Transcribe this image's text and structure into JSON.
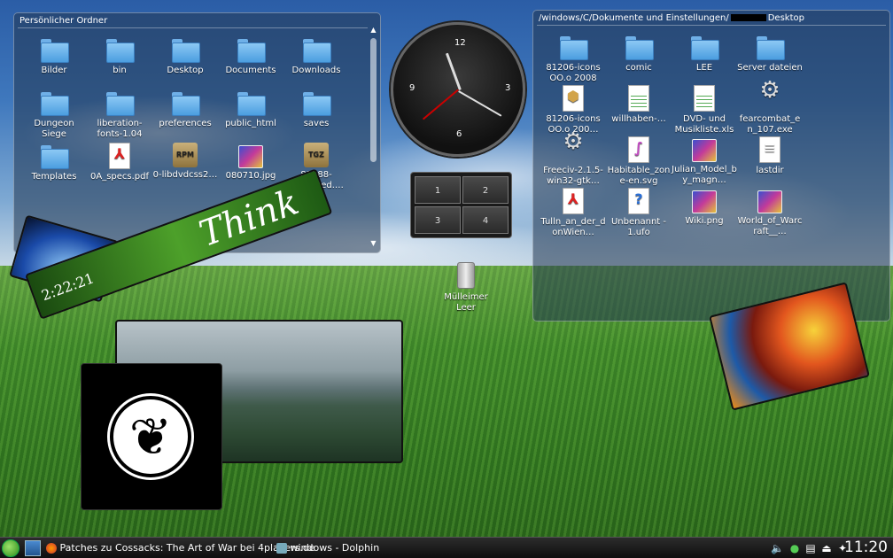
{
  "left_folder": {
    "title": "Persönlicher Ordner",
    "items": [
      {
        "label": "Bilder",
        "icon": "folder-icon"
      },
      {
        "label": "bin",
        "icon": "folder-icon"
      },
      {
        "label": "Desktop",
        "icon": "folder-icon"
      },
      {
        "label": "Documents",
        "icon": "folder-icon"
      },
      {
        "label": "Downloads",
        "icon": "folder-icon"
      },
      {
        "label": "Dungeon Siege",
        "icon": "folder-icon"
      },
      {
        "label": "liberation-fonts-1.04",
        "icon": "folder-icon"
      },
      {
        "label": "preferences",
        "icon": "folder-icon"
      },
      {
        "label": "public_html",
        "icon": "folder-icon"
      },
      {
        "label": "saves",
        "icon": "folder-icon"
      },
      {
        "label": "Templates",
        "icon": "folder-icon"
      },
      {
        "label": "0A_specs.pdf",
        "icon": "pdf-icon"
      },
      {
        "label": "0-libdvdcss2…",
        "icon": "rpm-package-icon",
        "glyph": "RPM"
      },
      {
        "label": "080710.jpg",
        "icon": "image-icon"
      },
      {
        "label": "81388-Glassified.…",
        "icon": "tgz-archive-icon",
        "glyph": "TGZ"
      }
    ]
  },
  "right_folder": {
    "title": "/windows/C/Dokumente und Einstellungen/",
    "title_tail": "Desktop",
    "items": [
      {
        "label": "81206-icons OO.o 2008",
        "icon": "folder-icon"
      },
      {
        "label": "comic",
        "icon": "folder-icon"
      },
      {
        "label": "LEE",
        "icon": "folder-icon"
      },
      {
        "label": "Server dateien",
        "icon": "folder-icon"
      },
      {
        "label": "81206-icons OO.o 200…",
        "icon": "installer-icon"
      },
      {
        "label": "willhaben-…",
        "icon": "spreadsheet-icon"
      },
      {
        "label": "DVD- und Musikliste.xls",
        "icon": "spreadsheet-icon"
      },
      {
        "label": "fearcombat_en_107.exe",
        "icon": "gear-icon"
      },
      {
        "label": "Freeciv-2.1.5-win32-gtk…",
        "icon": "gear-icon"
      },
      {
        "label": "Habitable_zone-en.svg",
        "icon": "svg-file-icon"
      },
      {
        "label": "Julian_Model_by_magn…",
        "icon": "image-icon"
      },
      {
        "label": "lastdir",
        "icon": "text-file-icon"
      },
      {
        "label": "Tulln_an_der_donWien…",
        "icon": "pdf-icon"
      },
      {
        "label": "Unbenannt - 1.ufo",
        "icon": "unknown-file-icon"
      },
      {
        "label": "Wiki.png",
        "icon": "image-icon"
      },
      {
        "label": "World_of_Warcraft__…",
        "icon": "image-icon"
      }
    ]
  },
  "clock": {
    "n12": "12",
    "n3": "3",
    "n6": "6",
    "n9": "9"
  },
  "pager": {
    "desktops": [
      "1",
      "2",
      "3",
      "4"
    ]
  },
  "trash": {
    "label": "Mülleimer Leer"
  },
  "think_widget": {
    "word": "Think",
    "time": "2:22:21"
  },
  "taskbar": {
    "tasks": [
      {
        "label": "Patches zu Cossacks: The Art of War bei 4players.de",
        "icon": "firefox-icon"
      },
      {
        "label": "windows - Dolphin",
        "icon": "dolphin-icon"
      }
    ],
    "clock": "11:20"
  }
}
